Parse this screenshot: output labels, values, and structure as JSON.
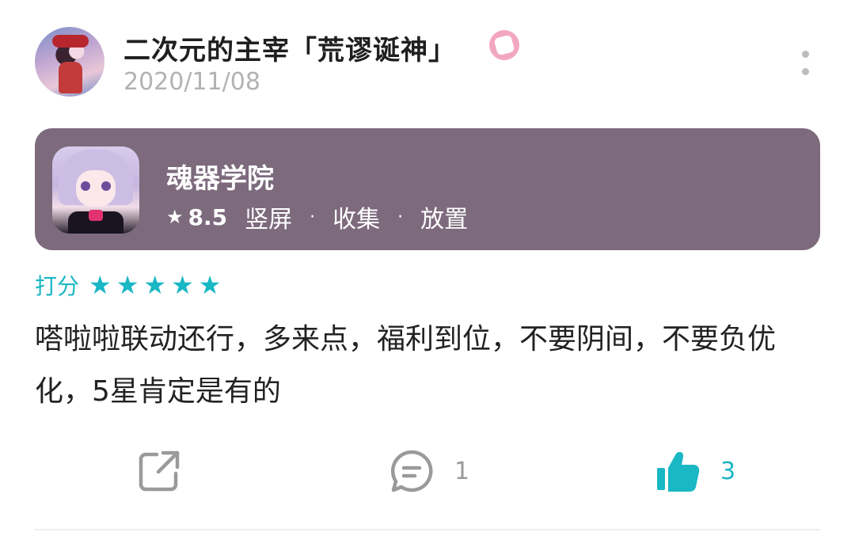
{
  "post": {
    "username": "二次元的主宰「荒谬诞神」",
    "date": "2020/11/08",
    "badge_icon": "pink-badge-icon",
    "more_icon": "more-vertical-icon"
  },
  "game": {
    "name": "魂器学院",
    "score": "8.5",
    "tags": [
      "竖屏",
      "收集",
      "放置"
    ],
    "separator": "·",
    "star_glyph": "★",
    "card_color": "#7d6a7d"
  },
  "rating": {
    "label": "打分",
    "stars": 5,
    "color": "#1ab7c4"
  },
  "review": {
    "text": "嗒啦啦联动还行，多来点，福利到位，不要阴间，不要负优化，5星肯定是有的"
  },
  "actions": {
    "share_icon": "share-icon",
    "comment_icon": "comment-icon",
    "comment_count": "1",
    "like_icon": "thumbs-up-icon",
    "like_count": "3",
    "like_color": "#1ab7c4"
  }
}
